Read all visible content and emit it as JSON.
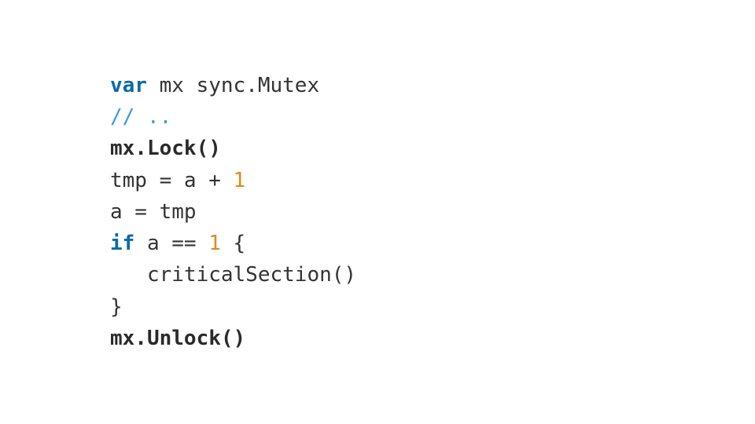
{
  "code": {
    "l1_kw": "var",
    "l1_rest": " mx sync.Mutex",
    "l2_comment": "// ..",
    "l3_bold": "mx.Lock()",
    "l4_a": "tmp = a + ",
    "l4_num": "1",
    "l5": "a = tmp",
    "l6_kw": "if",
    "l6_mid": " a == ",
    "l6_num": "1",
    "l6_end": " {",
    "l7": "   criticalSection()",
    "l8": "}",
    "l9_bold": "mx.Unlock()"
  }
}
